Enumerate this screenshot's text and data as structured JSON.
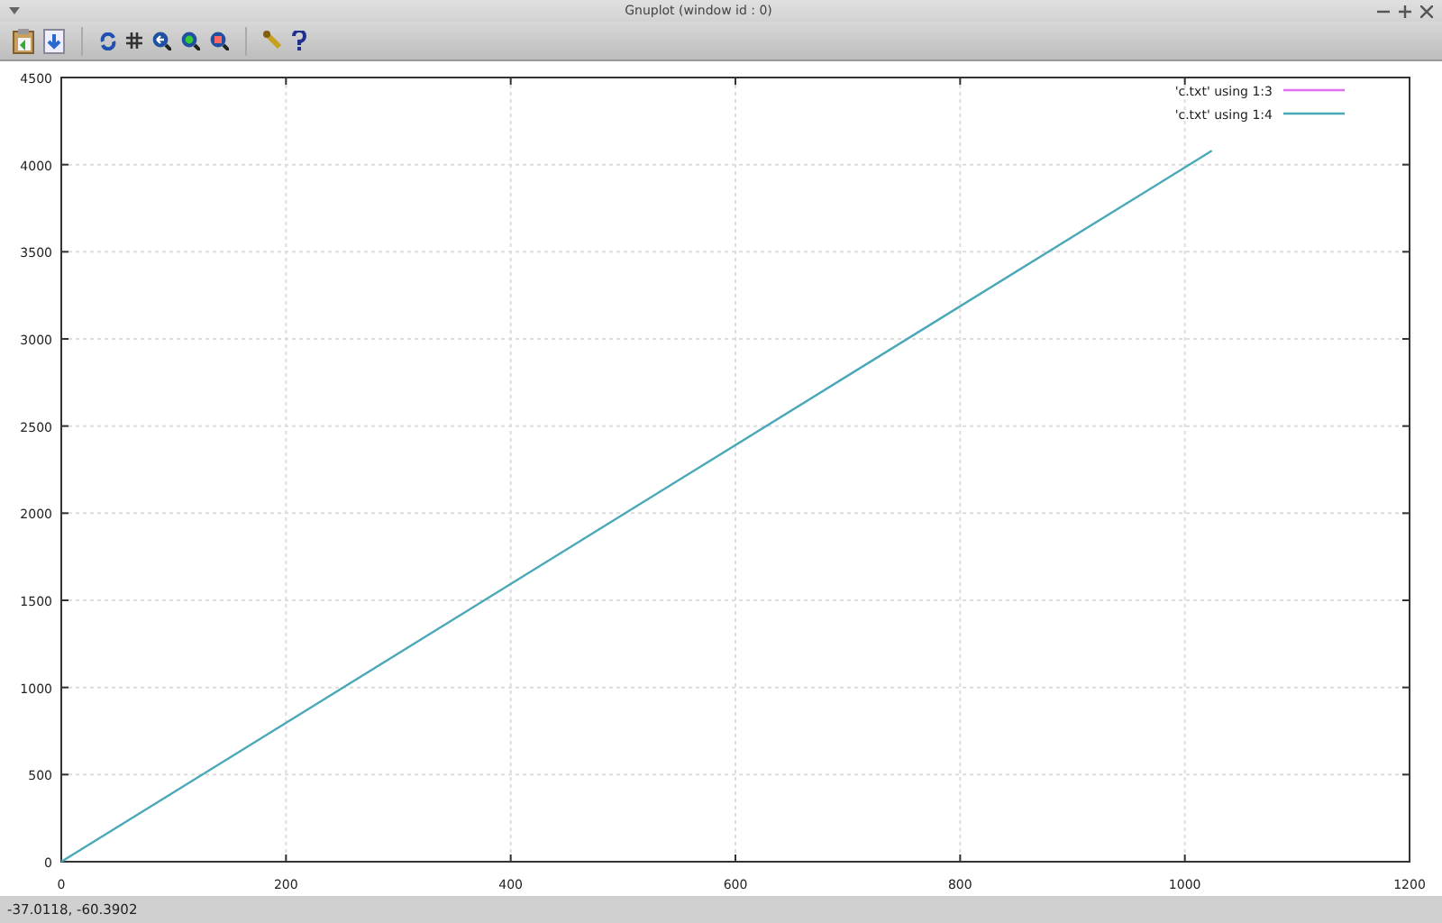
{
  "window": {
    "title": "Gnuplot (window id : 0)"
  },
  "plot": {
    "chart_data": {
      "type": "line",
      "x": [
        0,
        1024
      ],
      "series": [
        {
          "name": "'c.txt' using 1:3",
          "color": "#e070f0",
          "values": [
            null,
            null
          ]
        },
        {
          "name": "'c.txt' using 1:4",
          "color": "#4aa8b8",
          "values": [
            0,
            4080
          ]
        }
      ],
      "grid": true,
      "legend": true,
      "xlim": [
        0,
        1200
      ],
      "ylim": [
        0,
        4500
      ],
      "xticks": [
        0,
        200,
        400,
        600,
        800,
        1000,
        1200
      ],
      "yticks": [
        0,
        500,
        1000,
        1500,
        2000,
        2500,
        3000,
        3500,
        4000,
        4500
      ]
    }
  },
  "status_bar": {
    "text": "-37.0118, -60.3902"
  }
}
